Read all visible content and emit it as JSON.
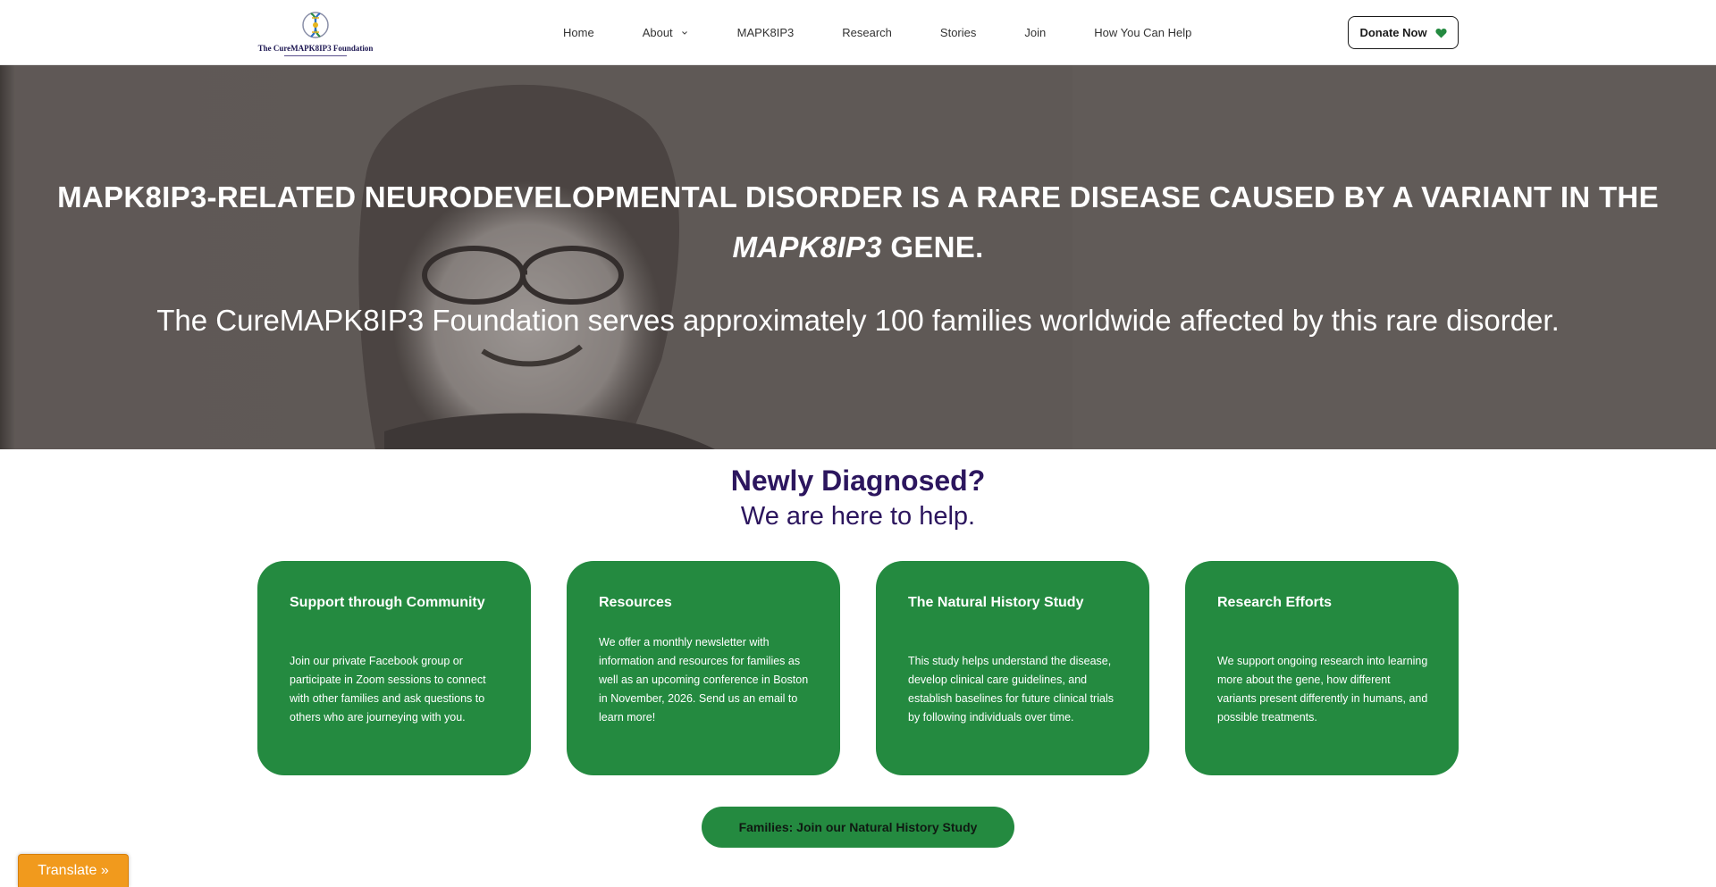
{
  "brand": {
    "name": "The CureMAPK8IP3 Foundation",
    "logo_icon": "dna-helix-logo-icon"
  },
  "nav": {
    "items": [
      {
        "label": "Home"
      },
      {
        "label": "About",
        "has_dropdown": true
      },
      {
        "label": "MAPK8IP3"
      },
      {
        "label": "Research"
      },
      {
        "label": "Stories"
      },
      {
        "label": "Join"
      },
      {
        "label": "How You Can Help"
      }
    ],
    "donate_label": "Donate Now",
    "donate_icon": "heart-icon",
    "donate_icon_color": "#248a40"
  },
  "hero": {
    "headline_before": "MAPK8IP3-RELATED NEURODEVELOPMENTAL DISORDER IS A RARE DISEASE CAUSED BY A VARIANT IN THE ",
    "headline_italic": "MAPK8IP3",
    "headline_after": " GENE.",
    "subheadline": "The CureMAPK8IP3 Foundation serves approximately 100 families worldwide affected by this rare disorder."
  },
  "newly_diagnosed": {
    "title": "Newly Diagnosed?",
    "subtitle": "We are here to help."
  },
  "cards": [
    {
      "title": "Support through Community",
      "body": "Join our private Facebook group or participate in Zoom sessions to connect with other families and ask questions to others who are journeying with you."
    },
    {
      "title": "Resources",
      "body": "We offer a monthly newsletter with information and resources for families as well as an upcoming conference in Boston in November, 2026. Send us an email to learn more!"
    },
    {
      "title": "The Natural History Study",
      "body": "This study helps understand the disease, develop clinical care guidelines, and establish baselines for future clinical trials by following individuals over time."
    },
    {
      "title": "Research Efforts",
      "body": "We support ongoing research into learning more about the gene, how different variants present differently in humans, and possible treatments."
    }
  ],
  "cta": {
    "label": "Families: Join our Natural History Study"
  },
  "translate": {
    "label": "Translate »"
  },
  "colors": {
    "accent_green": "#248a40",
    "heading_purple": "#2c165e",
    "translate_orange": "#f19a1d"
  }
}
